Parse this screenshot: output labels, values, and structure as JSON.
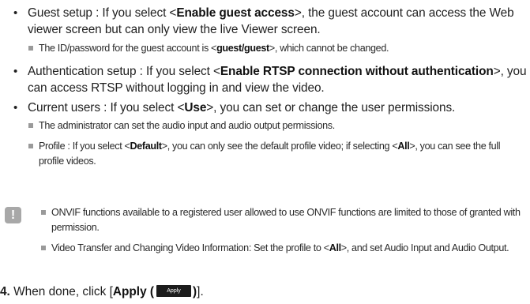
{
  "items": [
    {
      "prefix": "Guest setup : If you select <",
      "bold": "Enable guest access",
      "suffix": ">, the guest account can access the Web viewer screen but can only view the live Viewer screen."
    },
    {
      "prefix": "Authentication setup : If you select <",
      "bold": "Enable RTSP connection without authentication",
      "suffix": ">, you can access RTSP without logging in and view the video."
    },
    {
      "prefix": "Current users : If you select <",
      "bold": "Use",
      "suffix": ">, you can set or change the user permissions."
    }
  ],
  "guest_note": {
    "prefix": "The ID/password for the guest account is <",
    "bold": "guest/guest",
    "suffix": ">, which cannot be changed."
  },
  "user_notes": [
    {
      "text": "The administrator can set the audio input and audio output permissions."
    },
    {
      "p1": "Profile : If you select <",
      "b1": "Default",
      "p2": ">, you can only see the default profile video; if selecting <",
      "b2": "All",
      "p3": ">, you can see the full profile videos."
    }
  ],
  "note_box": {
    "icon": "!",
    "lines": [
      {
        "text": "ONVIF functions available to a registered user allowed to use ONVIF functions are limited to those of granted with permission."
      },
      {
        "p1": "Video Transfer and Changing Video Information: Set the profile to <",
        "b1": "All",
        "p2": ">, and set Audio Input and Audio Output."
      }
    ]
  },
  "step": {
    "number": "4.",
    "prefix": " When done, click [",
    "bold_open": "Apply (",
    "button_label": "Apply",
    "bold_close": ")",
    "suffix": "]."
  }
}
